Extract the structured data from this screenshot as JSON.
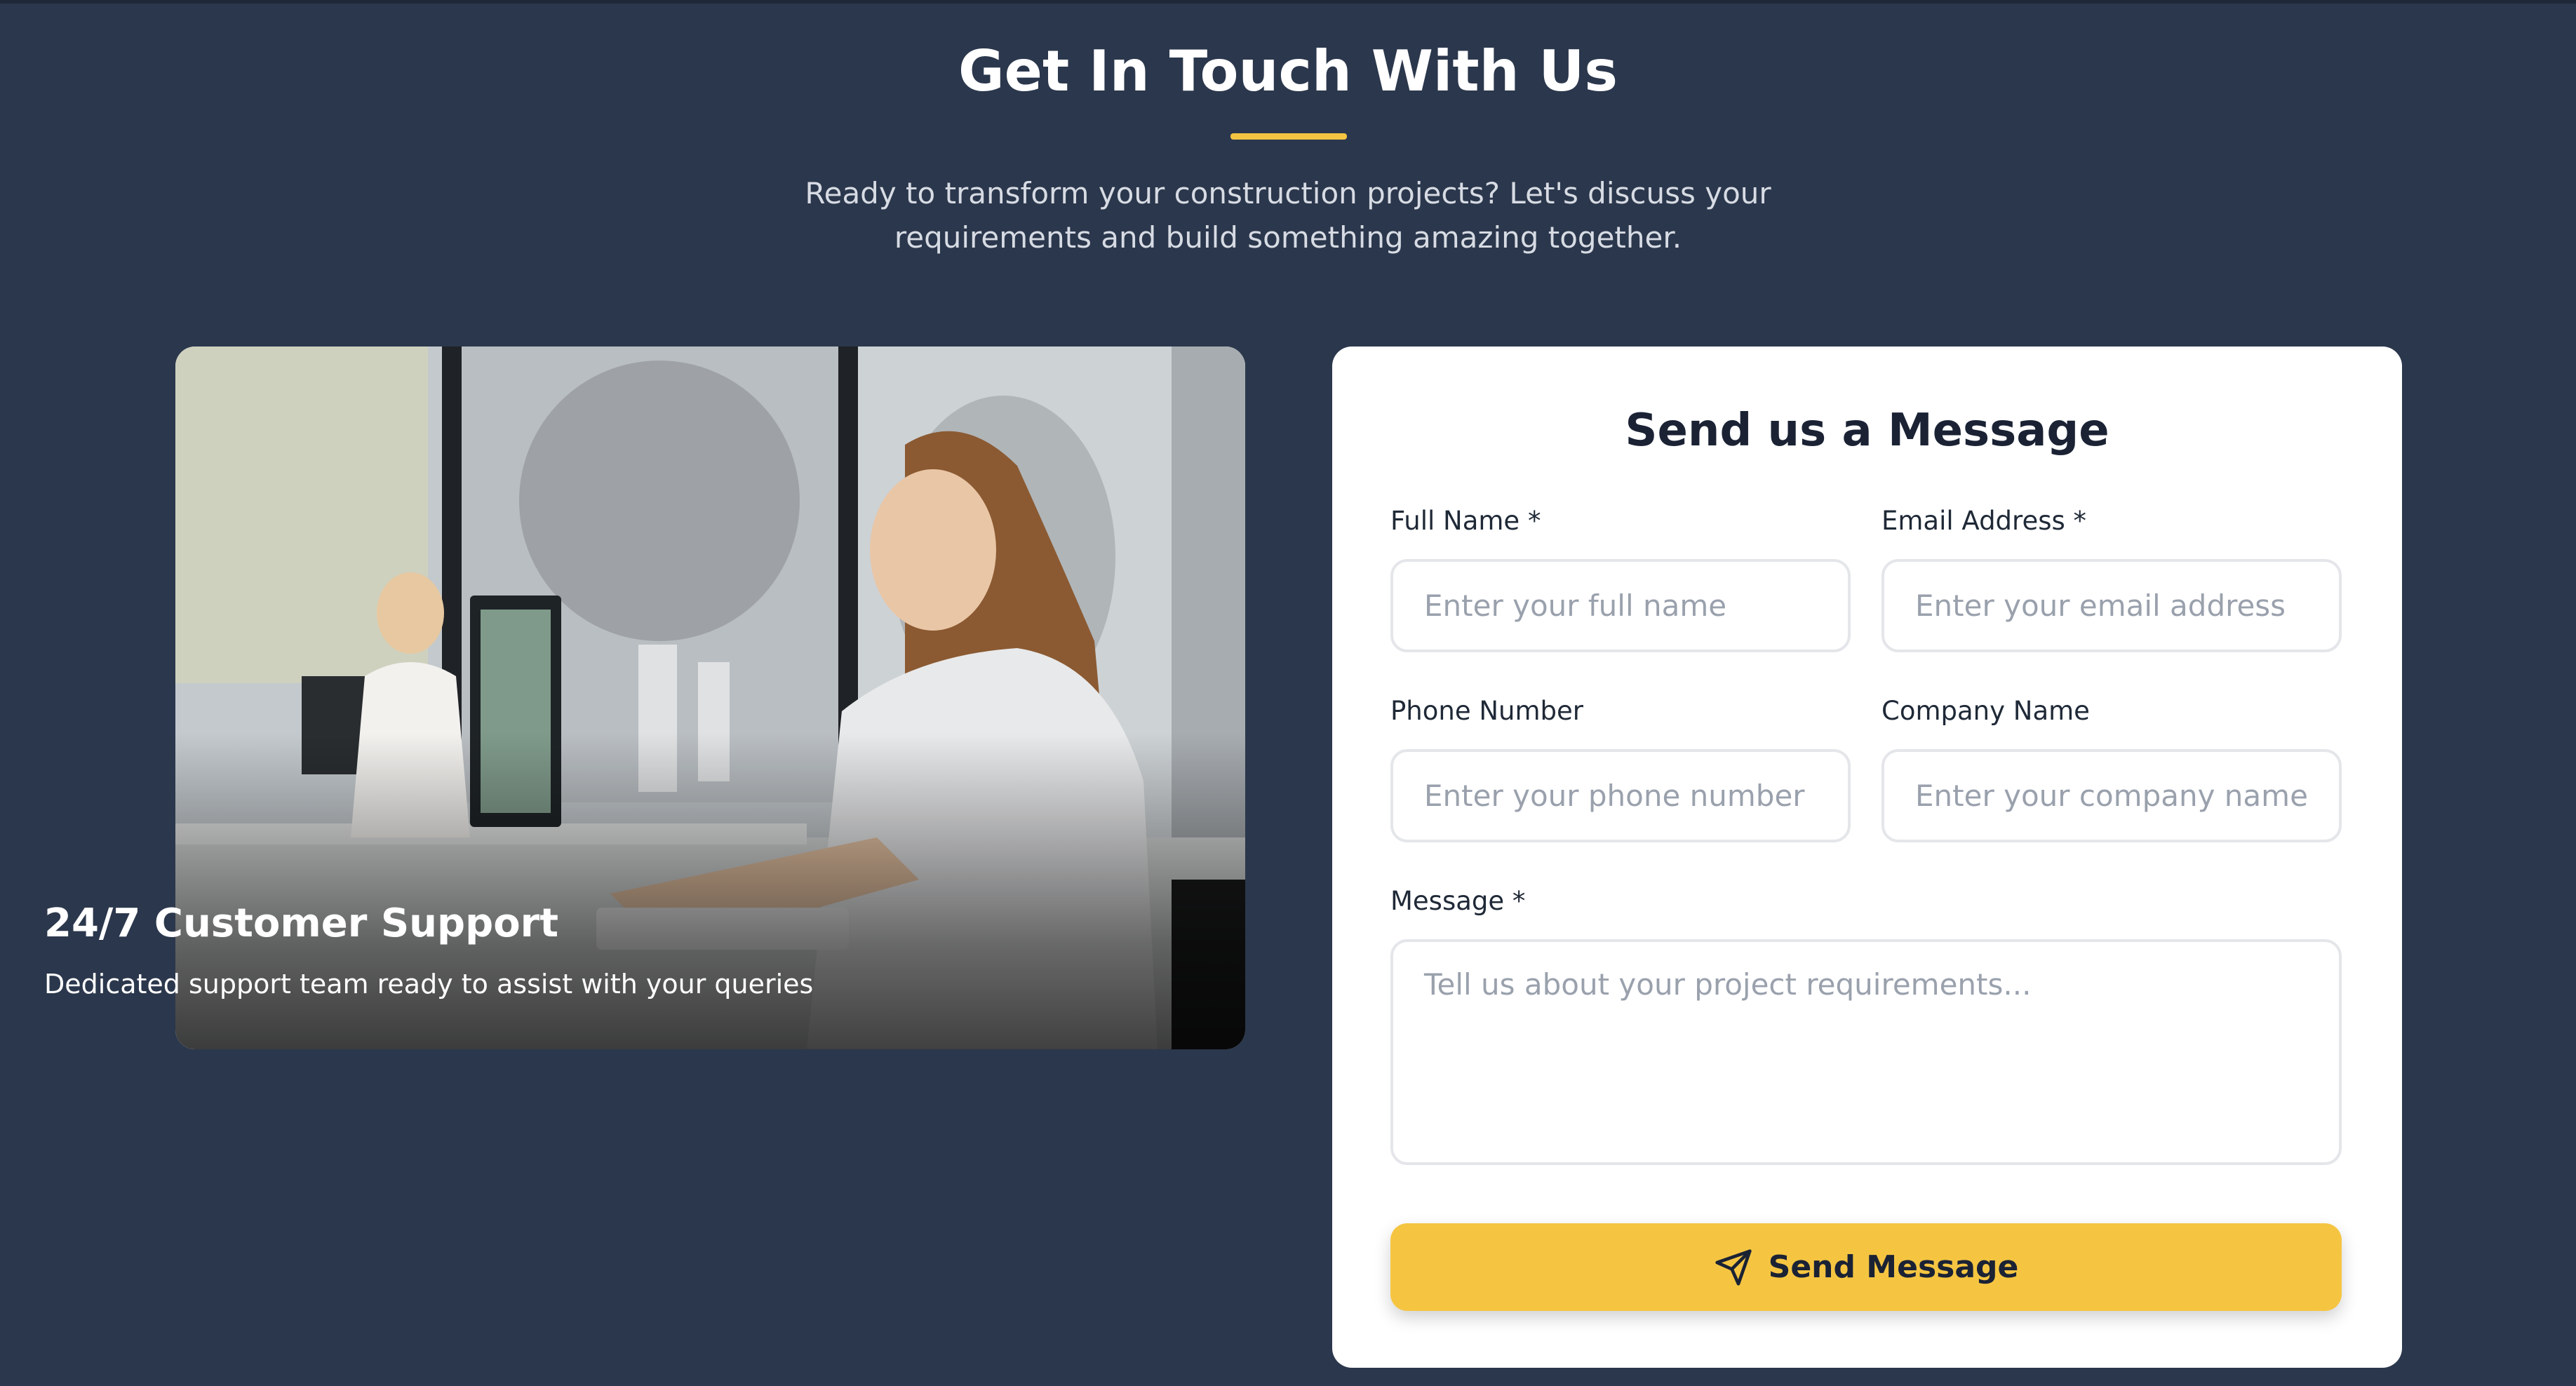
{
  "header": {
    "title": "Get In Touch With Us",
    "subtitle_line1": "Ready to transform your construction projects? Let's discuss your",
    "subtitle_line2": "requirements and build something amazing together."
  },
  "image_card": {
    "title": "24/7 Customer Support",
    "text": "Dedicated support team ready to assist with your queries"
  },
  "form": {
    "title": "Send us a Message",
    "full_name": {
      "label": "Full Name *",
      "placeholder": "Enter your full name",
      "value": ""
    },
    "email": {
      "label": "Email Address *",
      "placeholder": "Enter your email address",
      "value": ""
    },
    "phone": {
      "label": "Phone Number",
      "placeholder": "Enter your phone number",
      "value": ""
    },
    "company": {
      "label": "Company Name",
      "placeholder": "Enter your company name",
      "value": ""
    },
    "message": {
      "label": "Message *",
      "placeholder": "Tell us about your project requirements...",
      "value": ""
    },
    "submit_label": "Send Message",
    "submit_icon": "send-icon"
  },
  "colors": {
    "background": "#2b374c",
    "accent": "#f5c542",
    "card": "#ffffff",
    "heading_dark": "#1a2234"
  }
}
